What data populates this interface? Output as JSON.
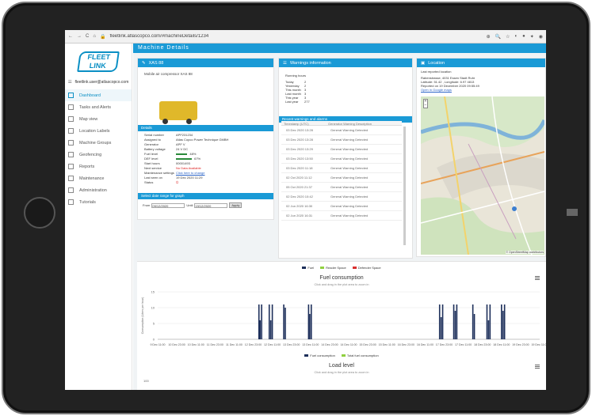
{
  "browser": {
    "url": "fleetlink.atlascopco.com/#machineDetails/1234",
    "back_icon": "←",
    "forward_icon": "→",
    "reload_icon": "C",
    "home_icon": "⌂"
  },
  "sidebar": {
    "logo_top": "FLEET",
    "logo_bottom": "LINK",
    "user": "fleetlink.user@atlascopco.com",
    "items": [
      {
        "label": "Dashboard",
        "icon": "grid-icon"
      },
      {
        "label": "Tasks and Alerts",
        "icon": "list-icon"
      },
      {
        "label": "Map view",
        "icon": "map-icon"
      },
      {
        "label": "Location Labels",
        "icon": "pin-icon"
      },
      {
        "label": "Machine Groups",
        "icon": "group-icon"
      },
      {
        "label": "Geofencing",
        "icon": "fence-icon"
      },
      {
        "label": "Reports",
        "icon": "report-icon"
      },
      {
        "label": "Maintenance",
        "icon": "wrench-icon"
      },
      {
        "label": "Administration",
        "icon": "gear-icon"
      },
      {
        "label": "Tutorials",
        "icon": "help-icon"
      }
    ]
  },
  "page": {
    "title": "Machine Details"
  },
  "info_panel": {
    "title": "XAS 88",
    "machine_description": "Mobile air compressor XAS 88",
    "subheader": "Details",
    "fields": [
      {
        "key": "Serial number",
        "value": "APF231234"
      },
      {
        "key": "Assigned to",
        "value": "Atlas Copco Power Technique GMBH"
      },
      {
        "key": "Generator",
        "value": "APF V"
      },
      {
        "key": "Battery voltage",
        "value": "24 V DC"
      },
      {
        "key": "Fuel level",
        "value": "48%"
      },
      {
        "key": "DEF level",
        "value": "67%"
      },
      {
        "key": "Start hours",
        "value": "00001493"
      },
      {
        "key": "Next service",
        "value": "No Data Available"
      },
      {
        "key": "Maintenance settings",
        "value": "Click here to change"
      },
      {
        "key": "Last seen on",
        "value": "19 Dec 2020 11:29"
      },
      {
        "key": "Status",
        "value": ""
      }
    ],
    "fuel_level_fraction": 0.48,
    "def_level_fraction": 0.67,
    "date_subheader": "Select date range for graph",
    "from_label": "From",
    "from_value": "09/12/2020",
    "to_label": "Until",
    "to_value": "19/12/2020",
    "apply_label": "Apply"
  },
  "warnings_panel": {
    "title": "Warnings information",
    "running_hours_label": "Running hours",
    "running_hours": [
      {
        "label": "Today",
        "value": "2"
      },
      {
        "label": "Yesterday",
        "value": "2"
      },
      {
        "label": "This month",
        "value": "3"
      },
      {
        "label": "Last month",
        "value": "3"
      },
      {
        "label": "This year",
        "value": "3"
      },
      {
        "label": "Last year",
        "value": "277"
      }
    ],
    "subheader": "Recent warnings and alarms",
    "columns": [
      "Timestamp (UTC)",
      "Generator Warning Description"
    ],
    "rows": [
      {
        "time": "03 Dec 2020 13:28",
        "desc": "General Warning Detected"
      },
      {
        "time": "03 Dec 2020 13:28",
        "desc": "General Warning Detected"
      },
      {
        "time": "03 Dec 2020 13:29",
        "desc": "General Warning Detected"
      },
      {
        "time": "03 Dec 2020 13:50",
        "desc": "General Warning Detected"
      },
      {
        "time": "03 Dec 2020 11:18",
        "desc": "General Warning Detected"
      },
      {
        "time": "02 Oct 2020 11:12",
        "desc": "General Warning Detected"
      },
      {
        "time": "05 Oct 2020 21:37",
        "desc": "General Warning Detected"
      },
      {
        "time": "02 Dec 2020 10:42",
        "desc": "General Warning Detected"
      },
      {
        "time": "02 Jun 2020 16:30",
        "desc": "General Warning Detected"
      },
      {
        "time": "02 Jun 2020 16:31",
        "desc": "General Warning Detected"
      }
    ]
  },
  "location_panel": {
    "title": "Location",
    "heading": "Last reported location",
    "address_line1": "Rabenstrasse, 4031 Essen Stadt Ruhr",
    "address_line2": "Latitude: 51.42 , Longitude: 6.97 4813",
    "address_line3": "Reported on 19 December 2020 09:55:49",
    "link": "Open in Google maps",
    "attribution": "© OpenStreetMap contributors",
    "zoom_in": "+",
    "zoom_out": "−"
  },
  "fuel_chart": {
    "legend": [
      {
        "name": "Fuel",
        "color": "#1d2f5a"
      },
      {
        "name": "Reader Space",
        "color": "#90d040"
      },
      {
        "name": "Defender Space",
        "color": "#d93030"
      }
    ],
    "title": "Fuel consumption",
    "subtitle": "Click and drag in the plot area to zoom in",
    "ylabel": "Consumption (Liters per hour)",
    "yticks": [
      "15",
      "10",
      "5",
      "0"
    ],
    "xticks": [
      "9 Dec 11:00",
      "10 Dec 23:00",
      "10 Dec 11:00",
      "11 Dec 23:00",
      "11 Dec 11:00",
      "12 Dec 23:00",
      "12 Dec 11:00",
      "13 Dec 23:00",
      "13 Dec 11:00",
      "14 Dec 23:00",
      "14 Dec 11:00",
      "15 Dec 23:00",
      "15 Dec 11:00",
      "16 Dec 23:00",
      "16 Dec 11:00",
      "17 Dec 23:00",
      "17 Dec 11:00",
      "18 Dec 23:00",
      "18 Dec 11:00",
      "19 Dec 23:00",
      "19 Dec 11:00"
    ],
    "bottom_legend": [
      {
        "name": "Fuel consumption",
        "color": "#1d2f5a"
      },
      {
        "name": "Total fuel consumption",
        "color": "#90d040"
      }
    ]
  },
  "chart_data": {
    "type": "bar",
    "title": "Fuel consumption",
    "subtitle": "Click and drag in the plot area to zoom in",
    "xlabel": "",
    "ylabel": "Consumption (Liters per hour)",
    "ylim": [
      0,
      15
    ],
    "x_range": [
      "9 Dec 11:00",
      "19 Dec 11:00"
    ],
    "series": [
      {
        "name": "Fuel consumption",
        "color": "#1d2f5a",
        "points": [
          {
            "x": 0.265,
            "y": 11
          },
          {
            "x": 0.268,
            "y": 6
          },
          {
            "x": 0.272,
            "y": 11
          },
          {
            "x": 0.292,
            "y": 11
          },
          {
            "x": 0.296,
            "y": 6
          },
          {
            "x": 0.3,
            "y": 11
          },
          {
            "x": 0.33,
            "y": 11
          },
          {
            "x": 0.334,
            "y": 10
          },
          {
            "x": 0.395,
            "y": 11
          },
          {
            "x": 0.398,
            "y": 8
          },
          {
            "x": 0.402,
            "y": 11
          },
          {
            "x": 0.738,
            "y": 11
          },
          {
            "x": 0.742,
            "y": 7
          },
          {
            "x": 0.746,
            "y": 11
          },
          {
            "x": 0.775,
            "y": 11
          },
          {
            "x": 0.779,
            "y": 9
          },
          {
            "x": 0.783,
            "y": 11
          },
          {
            "x": 0.825,
            "y": 11
          },
          {
            "x": 0.829,
            "y": 8
          },
          {
            "x": 0.862,
            "y": 11
          },
          {
            "x": 0.866,
            "y": 6
          },
          {
            "x": 0.87,
            "y": 11
          },
          {
            "x": 0.9,
            "y": 11
          },
          {
            "x": 0.904,
            "y": 9
          },
          {
            "x": 0.908,
            "y": 11
          }
        ]
      }
    ],
    "grid": true
  },
  "idle_chart": {
    "title": "Load level",
    "subtitle": "Click and drag in the plot area to zoom in",
    "ytick": "100"
  }
}
